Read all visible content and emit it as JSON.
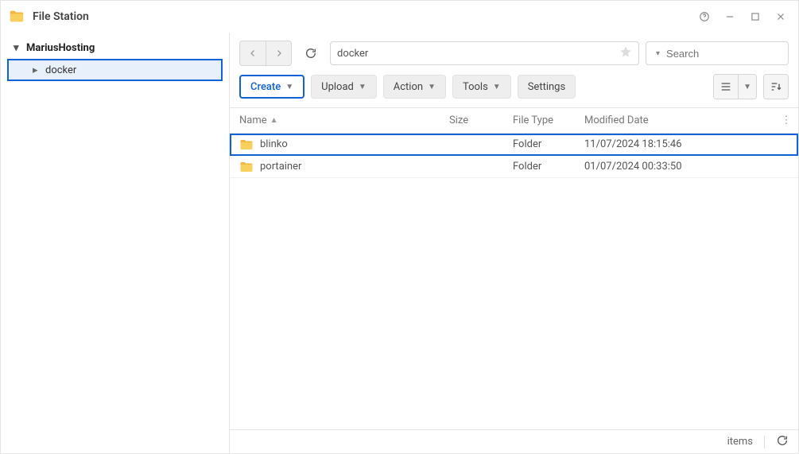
{
  "app": {
    "title": "File Station"
  },
  "sidebar": {
    "root": "MariusHosting",
    "items": [
      {
        "label": "docker"
      }
    ]
  },
  "nav": {
    "path": "docker",
    "search_placeholder": "Search"
  },
  "toolbar": {
    "create": "Create",
    "upload": "Upload",
    "action": "Action",
    "tools": "Tools",
    "settings": "Settings"
  },
  "columns": {
    "name": "Name",
    "size": "Size",
    "type": "File Type",
    "modified": "Modified Date"
  },
  "rows": [
    {
      "name": "blinko",
      "size": "",
      "type": "Folder",
      "modified": "11/07/2024 18:15:46",
      "selected": true
    },
    {
      "name": "portainer",
      "size": "",
      "type": "Folder",
      "modified": "01/07/2024 00:33:50",
      "selected": false
    }
  ],
  "status": {
    "items_label": "items"
  }
}
